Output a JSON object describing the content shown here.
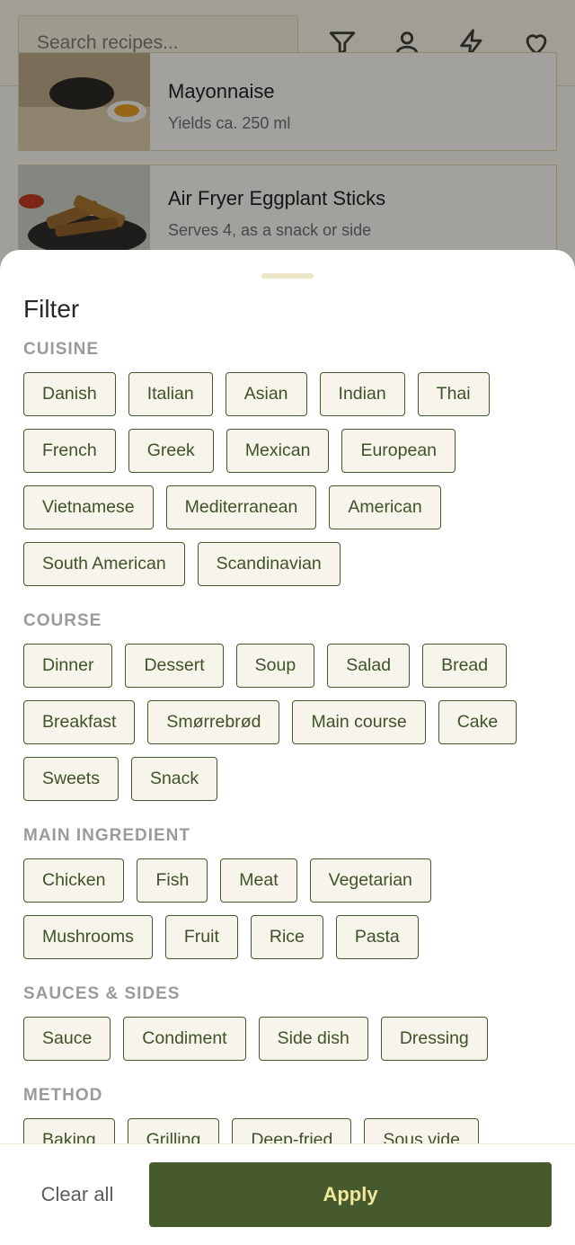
{
  "header": {
    "search_placeholder": "Search recipes...",
    "icons": [
      "filter-icon",
      "user-icon",
      "lightning-icon",
      "heart-icon"
    ]
  },
  "recipes": [
    {
      "title": "Mayonnaise",
      "subtitle": "Yields ca. 250 ml"
    },
    {
      "title": "Air Fryer Eggplant Sticks",
      "subtitle": "Serves 4, as a snack or side"
    }
  ],
  "filter": {
    "title": "Filter",
    "sections": [
      {
        "label": "CUISINE",
        "chips": [
          "Danish",
          "Italian",
          "Asian",
          "Indian",
          "Thai",
          "French",
          "Greek",
          "Mexican",
          "European",
          "Vietnamese",
          "Mediterranean",
          "American",
          "South American",
          "Scandinavian"
        ]
      },
      {
        "label": "COURSE",
        "chips": [
          "Dinner",
          "Dessert",
          "Soup",
          "Salad",
          "Bread",
          "Breakfast",
          "Smørrebrød",
          "Main course",
          "Cake",
          "Sweets",
          "Snack"
        ]
      },
      {
        "label": "MAIN INGREDIENT",
        "chips": [
          "Chicken",
          "Fish",
          "Meat",
          "Vegetarian",
          "Mushrooms",
          "Fruit",
          "Rice",
          "Pasta"
        ]
      },
      {
        "label": "SAUCES & SIDES",
        "chips": [
          "Sauce",
          "Condiment",
          "Side dish",
          "Dressing"
        ]
      },
      {
        "label": "METHOD",
        "chips": [
          "Baking",
          "Grilling",
          "Deep-fried",
          "Sous vide"
        ]
      }
    ]
  },
  "footer": {
    "clear_label": "Clear all",
    "apply_label": "Apply"
  },
  "colors": {
    "accent": "#465a2e",
    "apply_text": "#f0e89c",
    "chip_border": "#44592c"
  }
}
